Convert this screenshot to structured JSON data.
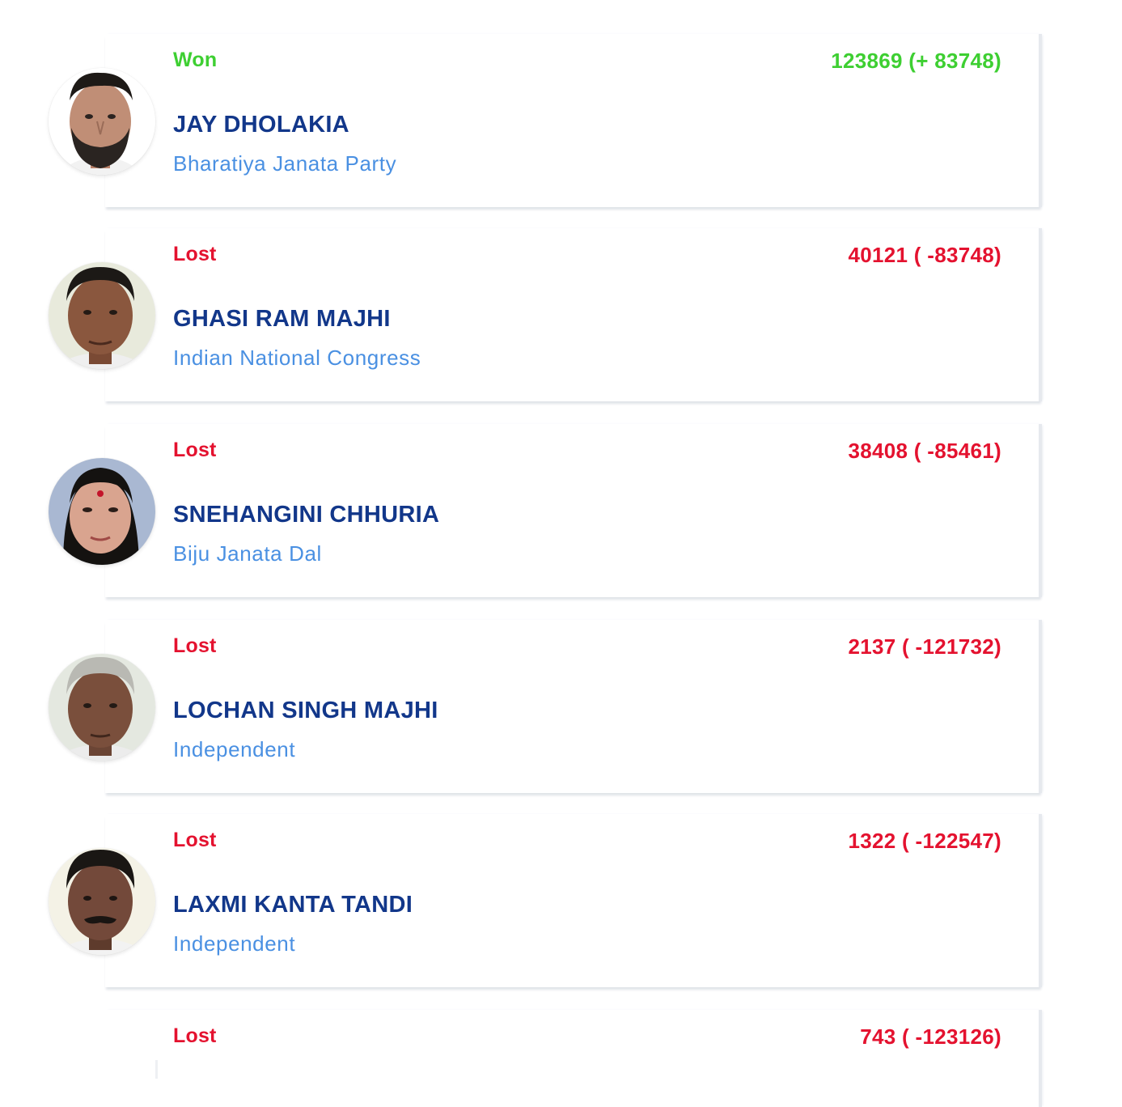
{
  "candidates": [
    {
      "status": "Won",
      "votes": "123869 (+ 83748)",
      "name": "JAY DHOLAKIA",
      "party": "Bharatiya Janata Party"
    },
    {
      "status": "Lost",
      "votes": "40121 ( -83748)",
      "name": "GHASI RAM MAJHI",
      "party": "Indian National Congress"
    },
    {
      "status": "Lost",
      "votes": "38408 ( -85461)",
      "name": "SNEHANGINI CHHURIA",
      "party": "Biju Janata Dal"
    },
    {
      "status": "Lost",
      "votes": "2137 ( -121732)",
      "name": "LOCHAN SINGH MAJHI",
      "party": "Independent"
    },
    {
      "status": "Lost",
      "votes": "1322 ( -122547)",
      "name": "LAXMI KANTA TANDI",
      "party": "Independent"
    },
    {
      "status": "Lost",
      "votes": "743 ( -123126)"
    }
  ],
  "colors": {
    "won": "#3ecf32",
    "lost": "#e4122f",
    "name": "#12378a",
    "party": "#4a90e2"
  }
}
